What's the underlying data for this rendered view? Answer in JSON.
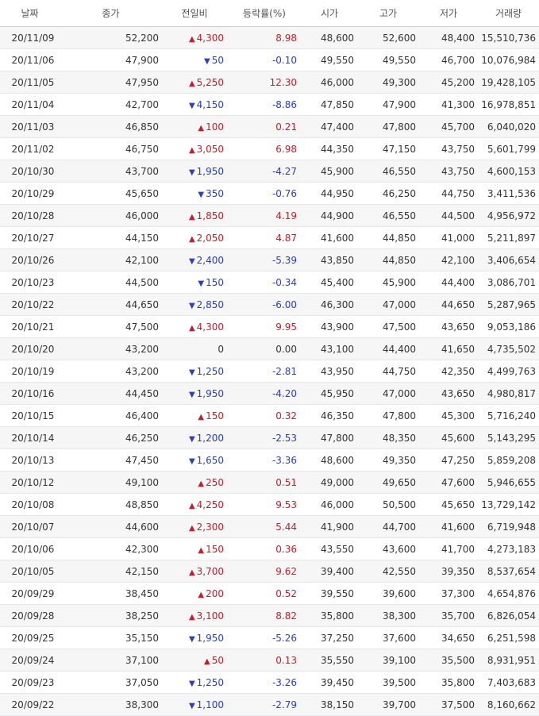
{
  "columns": [
    "날짜",
    "종가",
    "전일비",
    "등락률(%)",
    "시가",
    "고가",
    "저가",
    "거래량"
  ],
  "colors": {
    "up": "#c0202e",
    "down": "#2a3fb8",
    "flat": "#333333"
  },
  "rows": [
    {
      "date": "20/11/09",
      "close": "52,200",
      "dir": "up",
      "change": "4,300",
      "rate": "8.98",
      "open": "48,600",
      "high": "52,600",
      "low": "48,400",
      "volume": "15,510,736"
    },
    {
      "date": "20/11/06",
      "close": "47,900",
      "dir": "down",
      "change": "50",
      "rate": "-0.10",
      "open": "49,550",
      "high": "49,550",
      "low": "46,700",
      "volume": "10,076,984"
    },
    {
      "date": "20/11/05",
      "close": "47,950",
      "dir": "up",
      "change": "5,250",
      "rate": "12.30",
      "open": "46,000",
      "high": "49,300",
      "low": "45,200",
      "volume": "19,428,105"
    },
    {
      "date": "20/11/04",
      "close": "42,700",
      "dir": "down",
      "change": "4,150",
      "rate": "-8.86",
      "open": "47,850",
      "high": "47,900",
      "low": "41,300",
      "volume": "16,978,851"
    },
    {
      "date": "20/11/03",
      "close": "46,850",
      "dir": "up",
      "change": "100",
      "rate": "0.21",
      "open": "47,400",
      "high": "47,800",
      "low": "45,700",
      "volume": "6,040,020"
    },
    {
      "date": "20/11/02",
      "close": "46,750",
      "dir": "up",
      "change": "3,050",
      "rate": "6.98",
      "open": "44,350",
      "high": "47,150",
      "low": "43,750",
      "volume": "5,601,799"
    },
    {
      "date": "20/10/30",
      "close": "43,700",
      "dir": "down",
      "change": "1,950",
      "rate": "-4.27",
      "open": "45,900",
      "high": "46,550",
      "low": "43,750",
      "volume": "4,600,153"
    },
    {
      "date": "20/10/29",
      "close": "45,650",
      "dir": "down",
      "change": "350",
      "rate": "-0.76",
      "open": "44,950",
      "high": "46,250",
      "low": "44,750",
      "volume": "3,411,536"
    },
    {
      "date": "20/10/28",
      "close": "46,000",
      "dir": "up",
      "change": "1,850",
      "rate": "4.19",
      "open": "44,900",
      "high": "46,550",
      "low": "44,500",
      "volume": "4,956,972"
    },
    {
      "date": "20/10/27",
      "close": "44,150",
      "dir": "up",
      "change": "2,050",
      "rate": "4.87",
      "open": "41,600",
      "high": "44,850",
      "low": "41,000",
      "volume": "5,211,897"
    },
    {
      "date": "20/10/26",
      "close": "42,100",
      "dir": "down",
      "change": "2,400",
      "rate": "-5.39",
      "open": "43,850",
      "high": "44,850",
      "low": "42,100",
      "volume": "3,406,654"
    },
    {
      "date": "20/10/23",
      "close": "44,500",
      "dir": "down",
      "change": "150",
      "rate": "-0.34",
      "open": "45,400",
      "high": "45,900",
      "low": "44,400",
      "volume": "3,086,701"
    },
    {
      "date": "20/10/22",
      "close": "44,650",
      "dir": "down",
      "change": "2,850",
      "rate": "-6.00",
      "open": "46,300",
      "high": "47,000",
      "low": "44,650",
      "volume": "5,287,965"
    },
    {
      "date": "20/10/21",
      "close": "47,500",
      "dir": "up",
      "change": "4,300",
      "rate": "9.95",
      "open": "43,900",
      "high": "47,500",
      "low": "43,650",
      "volume": "9,053,186"
    },
    {
      "date": "20/10/20",
      "close": "43,200",
      "dir": "flat",
      "change": "0",
      "rate": "0.00",
      "open": "43,100",
      "high": "44,400",
      "low": "41,650",
      "volume": "4,735,502"
    },
    {
      "date": "20/10/19",
      "close": "43,200",
      "dir": "down",
      "change": "1,250",
      "rate": "-2.81",
      "open": "43,950",
      "high": "44,750",
      "low": "42,350",
      "volume": "4,499,763"
    },
    {
      "date": "20/10/16",
      "close": "44,450",
      "dir": "down",
      "change": "1,950",
      "rate": "-4.20",
      "open": "45,950",
      "high": "47,000",
      "low": "43,650",
      "volume": "4,980,817"
    },
    {
      "date": "20/10/15",
      "close": "46,400",
      "dir": "up",
      "change": "150",
      "rate": "0.32",
      "open": "46,350",
      "high": "47,800",
      "low": "45,300",
      "volume": "5,716,240"
    },
    {
      "date": "20/10/14",
      "close": "46,250",
      "dir": "down",
      "change": "1,200",
      "rate": "-2.53",
      "open": "47,800",
      "high": "48,350",
      "low": "45,600",
      "volume": "5,143,295"
    },
    {
      "date": "20/10/13",
      "close": "47,450",
      "dir": "down",
      "change": "1,650",
      "rate": "-3.36",
      "open": "48,600",
      "high": "49,350",
      "low": "47,250",
      "volume": "5,859,208"
    },
    {
      "date": "20/10/12",
      "close": "49,100",
      "dir": "up",
      "change": "250",
      "rate": "0.51",
      "open": "49,000",
      "high": "49,650",
      "low": "47,600",
      "volume": "5,946,655"
    },
    {
      "date": "20/10/08",
      "close": "48,850",
      "dir": "up",
      "change": "4,250",
      "rate": "9.53",
      "open": "46,000",
      "high": "50,500",
      "low": "45,650",
      "volume": "13,729,142"
    },
    {
      "date": "20/10/07",
      "close": "44,600",
      "dir": "up",
      "change": "2,300",
      "rate": "5.44",
      "open": "41,900",
      "high": "44,700",
      "low": "41,600",
      "volume": "6,719,948"
    },
    {
      "date": "20/10/06",
      "close": "42,300",
      "dir": "up",
      "change": "150",
      "rate": "0.36",
      "open": "43,550",
      "high": "43,600",
      "low": "41,700",
      "volume": "4,273,183"
    },
    {
      "date": "20/10/05",
      "close": "42,150",
      "dir": "up",
      "change": "3,700",
      "rate": "9.62",
      "open": "39,400",
      "high": "42,550",
      "low": "39,350",
      "volume": "8,537,654"
    },
    {
      "date": "20/09/29",
      "close": "38,450",
      "dir": "up",
      "change": "200",
      "rate": "0.52",
      "open": "39,550",
      "high": "39,600",
      "low": "37,300",
      "volume": "4,654,876"
    },
    {
      "date": "20/09/28",
      "close": "38,250",
      "dir": "up",
      "change": "3,100",
      "rate": "8.82",
      "open": "35,800",
      "high": "38,300",
      "low": "35,700",
      "volume": "6,826,054"
    },
    {
      "date": "20/09/25",
      "close": "35,150",
      "dir": "down",
      "change": "1,950",
      "rate": "-5.26",
      "open": "37,250",
      "high": "37,600",
      "low": "34,650",
      "volume": "6,251,598"
    },
    {
      "date": "20/09/24",
      "close": "37,100",
      "dir": "up",
      "change": "50",
      "rate": "0.13",
      "open": "35,550",
      "high": "39,100",
      "low": "35,500",
      "volume": "8,931,951"
    },
    {
      "date": "20/09/23",
      "close": "37,050",
      "dir": "down",
      "change": "1,250",
      "rate": "-3.26",
      "open": "39,450",
      "high": "39,500",
      "low": "35,800",
      "volume": "7,403,683"
    },
    {
      "date": "20/09/22",
      "close": "38,300",
      "dir": "down",
      "change": "1,100",
      "rate": "-2.79",
      "open": "38,150",
      "high": "39,700",
      "low": "37,500",
      "volume": "8,160,662"
    }
  ]
}
